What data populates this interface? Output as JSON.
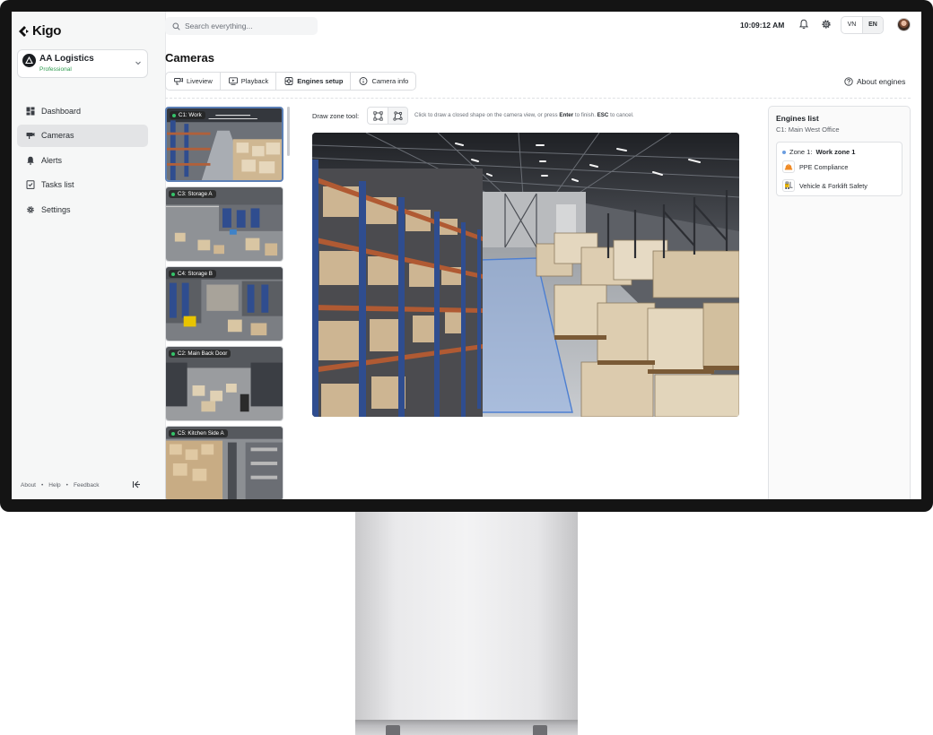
{
  "app": {
    "brand": "Kigo",
    "org_name": "AA Logistics",
    "org_plan": "Professional"
  },
  "sidebar": {
    "items": [
      {
        "label": "Dashboard",
        "icon": "dashboard-icon"
      },
      {
        "label": "Cameras",
        "icon": "camera-icon",
        "active": true
      },
      {
        "label": "Alerts",
        "icon": "bell-icon"
      },
      {
        "label": "Tasks list",
        "icon": "checklist-icon"
      },
      {
        "label": "Settings",
        "icon": "gear-icon"
      }
    ],
    "footer": {
      "about": "About",
      "help": "Help",
      "feedback": "Feedback",
      "separator": "•"
    }
  },
  "topbar": {
    "search_placeholder": "Search everything...",
    "time": "10:09:12 AM",
    "lang_options": [
      "VN",
      "EN"
    ],
    "lang_selected": "EN"
  },
  "page": {
    "title": "Cameras",
    "tabs": [
      {
        "label": "Liveview",
        "icon": "liveview-icon"
      },
      {
        "label": "Playback",
        "icon": "playback-icon"
      },
      {
        "label": "Engines setup",
        "icon": "engines-icon",
        "active": true
      },
      {
        "label": "Camera info",
        "icon": "info-icon"
      }
    ],
    "about_engines": "About engines"
  },
  "cameras": [
    {
      "label": "C1: Work",
      "selected": true
    },
    {
      "label": "C3: Storage A"
    },
    {
      "label": "C4: Storage B"
    },
    {
      "label": "C2: Main Back Door"
    },
    {
      "label": "C5: Kitchen Side A"
    }
  ],
  "draw": {
    "label": "Draw zone tool:",
    "hint_pre": "Click to draw a closed shape on the camera view, or press",
    "hint_key1": "Enter",
    "hint_mid": "to finish.",
    "hint_key2": "ESC",
    "hint_post": "to cancel."
  },
  "engines": {
    "title": "Engines list",
    "camera": "C1: Main West Office",
    "zone_prefix": "Zone 1:",
    "zone_name": "Work zone 1",
    "items": [
      {
        "label": "PPE Compliance",
        "icon": "hardhat-icon",
        "color": "#f08a24"
      },
      {
        "label": "Vehicle & Forklift Safety",
        "icon": "forklift-icon",
        "color": "#e8b400"
      }
    ]
  },
  "colors": {
    "accent": "#5b7fb6",
    "live": "#35c46a",
    "plan": "#2e9b4f",
    "zone": "#6a9de0"
  }
}
